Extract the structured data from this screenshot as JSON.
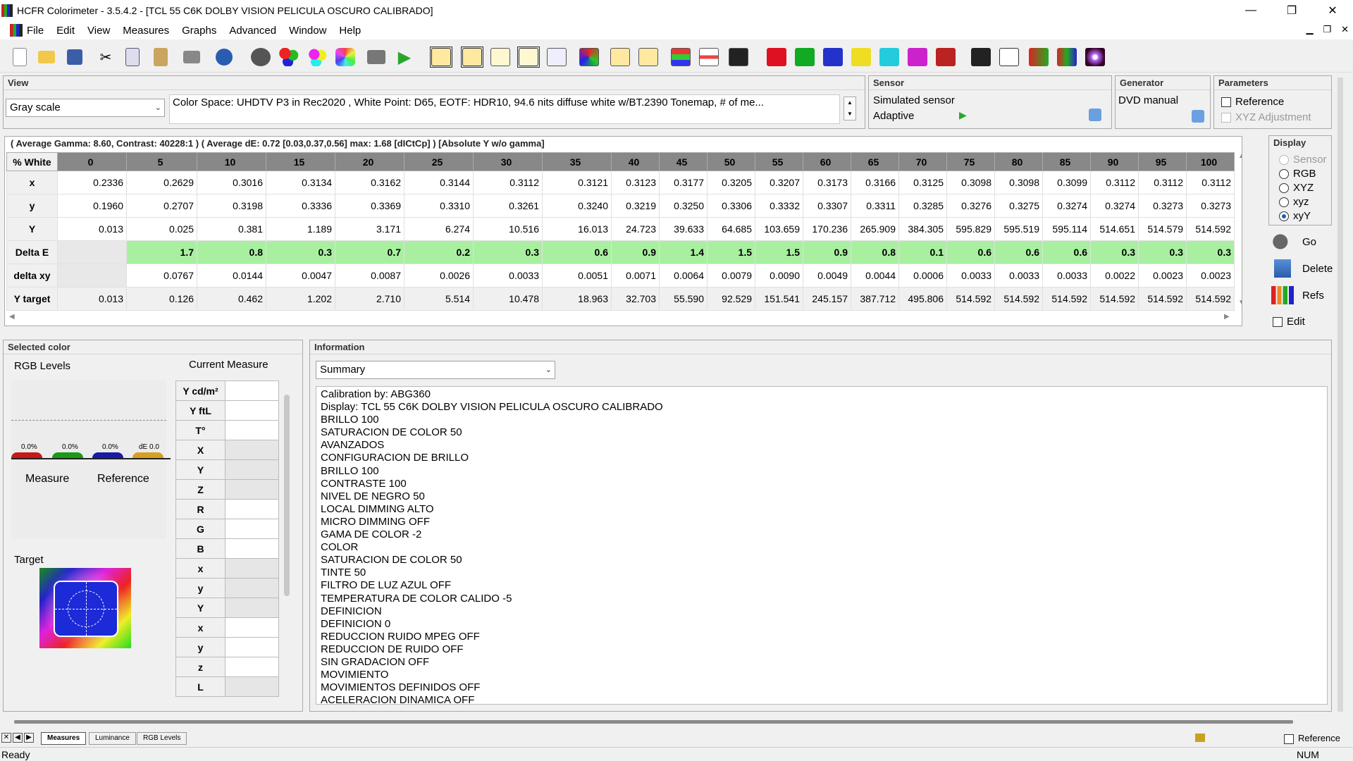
{
  "window": {
    "title": "HCFR Colorimeter - 3.5.4.2 - [TCL 55 C6K DOLBY VISION PELICULA OSCURO CALIBRADO]",
    "minimize": "—",
    "maximize": "❐",
    "close": "✕"
  },
  "menu": {
    "items": [
      "File",
      "Edit",
      "View",
      "Measures",
      "Graphs",
      "Advanced",
      "Window",
      "Help"
    ],
    "mdi_minimize": "▁",
    "mdi_restore": "❐",
    "mdi_close": "✕"
  },
  "view": {
    "header": "View",
    "mode": "Gray scale",
    "color_space_info": "Color Space: UHDTV P3 in Rec2020 , White Point: D65, EOTF:  HDR10, 94.6 nits diffuse white w/BT.2390 Tonemap, # of me..."
  },
  "sensor": {
    "header": "Sensor",
    "name": "Simulated sensor",
    "mode": "Adaptive"
  },
  "generator": {
    "header": "Generator",
    "name": "DVD manual"
  },
  "parameters": {
    "header": "Parameters",
    "reference_label": "Reference",
    "xyz_adjustment_label": "XYZ Adjustment"
  },
  "summary_line": "( Average Gamma: 8.60, Contrast: 40228:1 ) ( Average dE: 0.72 [0.03,0.37,0.56] max: 1.68 [dICtCp] ) [Absolute Y w/o gamma]",
  "grid": {
    "row_header": "% White",
    "columns": [
      "0",
      "5",
      "10",
      "15",
      "20",
      "25",
      "30",
      "35",
      "40",
      "45",
      "50",
      "55",
      "60",
      "65",
      "70",
      "75",
      "80",
      "85",
      "90",
      "95",
      "100"
    ],
    "rows": [
      {
        "label": "x",
        "values": [
          "0.2336",
          "0.2629",
          "0.3016",
          "0.3134",
          "0.3162",
          "0.3144",
          "0.3112",
          "0.3121",
          "0.3123",
          "0.3177",
          "0.3205",
          "0.3207",
          "0.3173",
          "0.3166",
          "0.3125",
          "0.3098",
          "0.3098",
          "0.3099",
          "0.3112",
          "0.3112",
          "0.3112"
        ]
      },
      {
        "label": "y",
        "values": [
          "0.1960",
          "0.2707",
          "0.3198",
          "0.3336",
          "0.3369",
          "0.3310",
          "0.3261",
          "0.3240",
          "0.3219",
          "0.3250",
          "0.3306",
          "0.3332",
          "0.3307",
          "0.3311",
          "0.3285",
          "0.3276",
          "0.3275",
          "0.3274",
          "0.3274",
          "0.3273",
          "0.3273"
        ]
      },
      {
        "label": "Y",
        "values": [
          "0.013",
          "0.025",
          "0.381",
          "1.189",
          "3.171",
          "6.274",
          "10.516",
          "16.013",
          "24.723",
          "39.633",
          "64.685",
          "103.659",
          "170.236",
          "265.909",
          "384.305",
          "595.829",
          "595.519",
          "595.114",
          "514.651",
          "514.579",
          "514.592"
        ]
      },
      {
        "label": "Delta E",
        "values": [
          "",
          "1.7",
          "0.8",
          "0.3",
          "0.7",
          "0.2",
          "0.3",
          "0.6",
          "0.9",
          "1.4",
          "1.5",
          "1.5",
          "0.9",
          "0.8",
          "0.1",
          "0.6",
          "0.6",
          "0.6",
          "0.3",
          "0.3",
          "0.3"
        ]
      },
      {
        "label": "delta xy",
        "values": [
          "",
          "0.0767",
          "0.0144",
          "0.0047",
          "0.0087",
          "0.0026",
          "0.0033",
          "0.0051",
          "0.0071",
          "0.0064",
          "0.0079",
          "0.0090",
          "0.0049",
          "0.0044",
          "0.0006",
          "0.0033",
          "0.0033",
          "0.0033",
          "0.0022",
          "0.0023",
          "0.0023"
        ]
      },
      {
        "label": "Y target",
        "values": [
          "0.013",
          "0.126",
          "0.462",
          "1.202",
          "2.710",
          "5.514",
          "10.478",
          "18.963",
          "32.703",
          "55.590",
          "92.529",
          "151.541",
          "245.157",
          "387.712",
          "495.806",
          "514.592",
          "514.592",
          "514.592",
          "514.592",
          "514.592",
          "514.592"
        ]
      }
    ]
  },
  "display": {
    "header": "Display",
    "options": [
      "Sensor",
      "RGB",
      "XYZ",
      "xyz",
      "xyY"
    ],
    "selected": "xyY",
    "go": "Go",
    "delete": "Delete",
    "refs": "Refs",
    "edit": "Edit"
  },
  "selected_color": {
    "header": "Selected color",
    "rgb_levels": "RGB Levels",
    "current_measure": "Current Measure",
    "levels": [
      "0.0%",
      "0.0%",
      "0.0%",
      "dE 0.0"
    ],
    "measure": "Measure",
    "reference": "Reference",
    "target": "Target",
    "table_keys": [
      "Y cd/m²",
      "Y ftL",
      "T°",
      "X",
      "Y",
      "Z",
      "R",
      "G",
      "B",
      "x",
      "y",
      "Y",
      "x",
      "y",
      "z",
      "L"
    ]
  },
  "information": {
    "header": "Information",
    "dropdown": "Summary",
    "lines": [
      "Calibration by: ABG360",
      "Display: TCL 55 C6K DOLBY VISION PELICULA OSCURO CALIBRADO",
      "BRILLO 100",
      "SATURACION DE COLOR 50",
      "AVANZADOS",
      "CONFIGURACION DE BRILLO",
      "BRILLO 100",
      "CONTRASTE 100",
      "NIVEL DE NEGRO 50",
      "LOCAL DIMMING ALTO",
      "MICRO DIMMING OFF",
      "GAMA DE COLOR -2",
      "COLOR",
      "SATURACION DE COLOR 50",
      "TINTE 50",
      "FILTRO DE LUZ AZUL OFF",
      "TEMPERATURA DE COLOR CALIDO -5",
      "DEFINICION",
      "DEFINICION 0",
      "REDUCCION RUIDO MPEG OFF",
      "REDUCCION DE RUIDO OFF",
      "SIN GRADACION OFF",
      "MOVIMIENTO",
      "MOVIMIENTOS DEFINIDOS OFF",
      "ACELERACION DINAMICA OFF"
    ]
  },
  "bottom_tabs": [
    "Measures",
    "Luminance",
    "RGB Levels"
  ],
  "bottom_reference": "Reference",
  "status": {
    "left": "Ready",
    "right": "NUM"
  }
}
